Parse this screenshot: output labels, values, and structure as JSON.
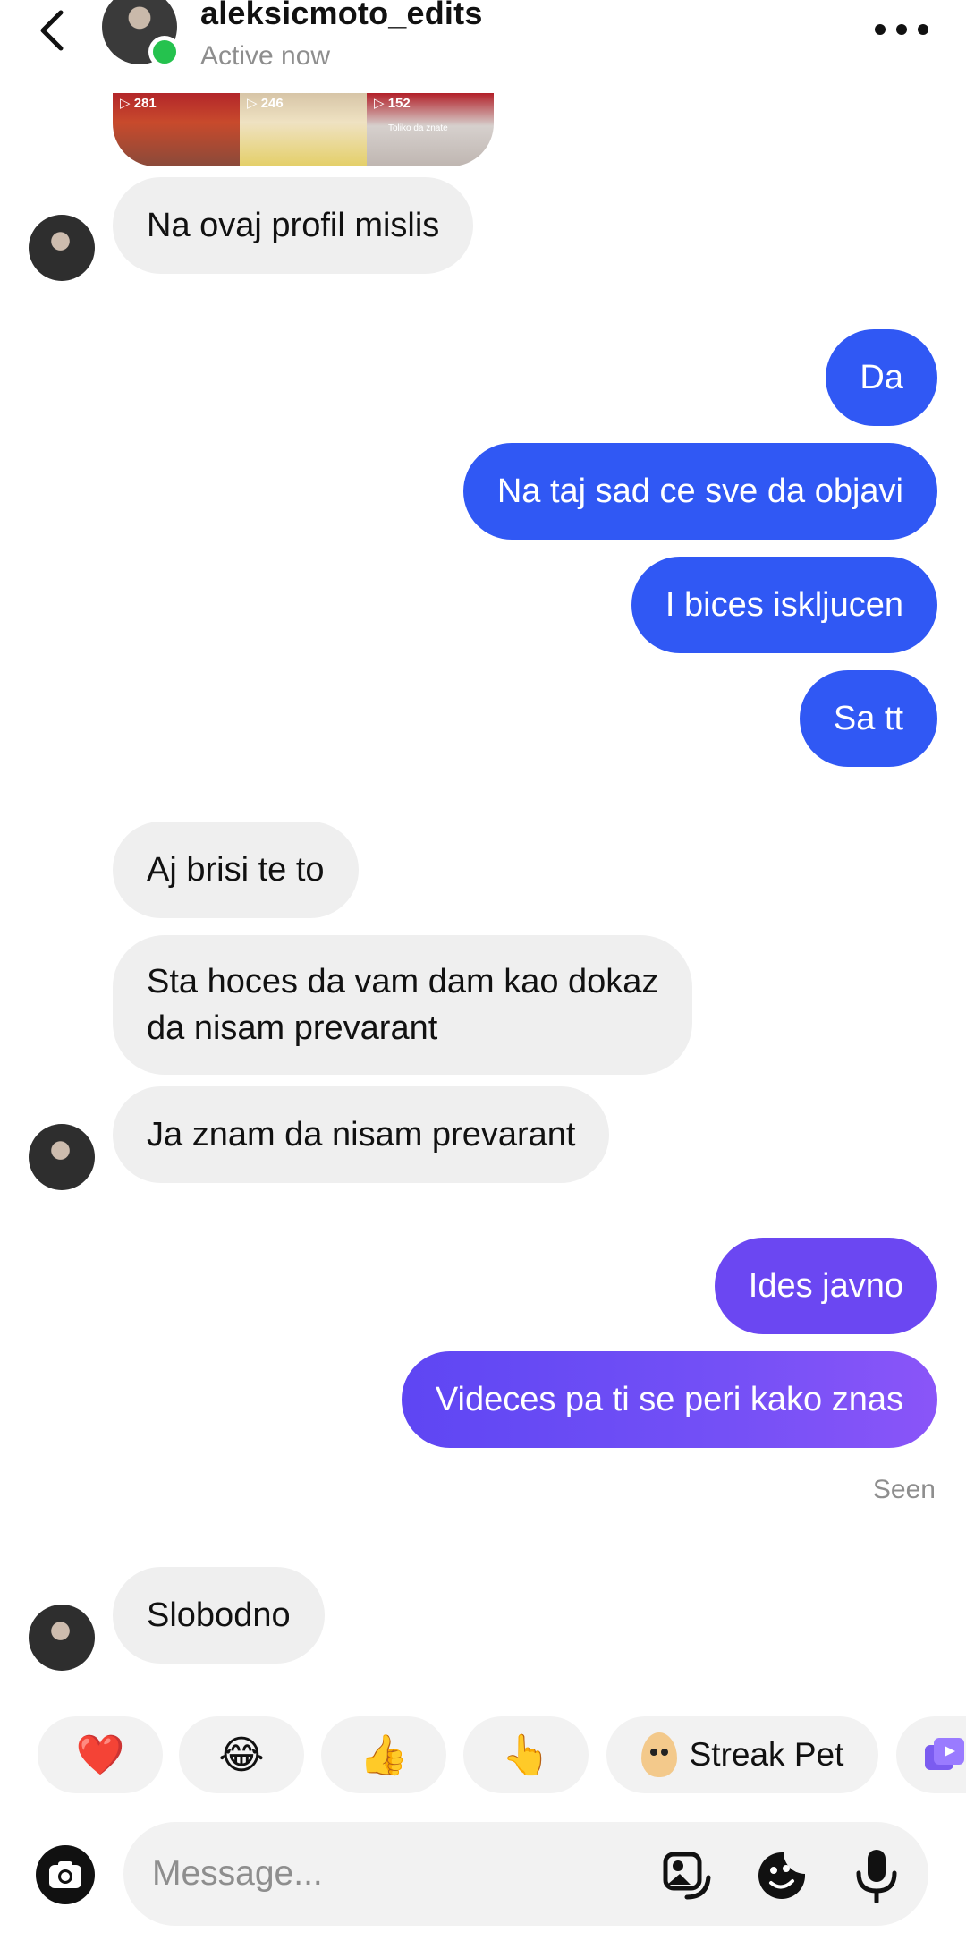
{
  "header": {
    "username": "aleksicmoto_edits",
    "status": "Active now",
    "back_icon": "chevron-left-icon",
    "more_icon": "more-horizontal-icon"
  },
  "shared_post": {
    "counts": [
      "281",
      "246",
      "152"
    ],
    "caption": "Toliko da znate"
  },
  "messages": {
    "m1": "Na ovaj profil mislis",
    "m2": "Da",
    "m3": "Na taj  sad ce sve da objavi",
    "m4": "I bices iskljucen",
    "m5": "Sa tt",
    "m6": "Aj brisi te to",
    "m7a": "Sta hoces da vam dam kao dokaz",
    "m7b": "da nisam prevarant",
    "m8": "Ja znam da nisam prevarant",
    "m9": "Ides javno",
    "m10": "Videces pa ti se peri kako znas",
    "seen": "Seen",
    "m11": "Slobodno"
  },
  "quick_reactions": {
    "r1": "❤️",
    "r2": "😂",
    "r3": "👍",
    "r4": "👆",
    "streak_label": "Streak Pet"
  },
  "composer": {
    "placeholder": "Message...",
    "icons": [
      "camera-icon",
      "sticker-photo-icon",
      "sticker-icon",
      "microphone-icon"
    ]
  },
  "colors": {
    "sent_blue": "#3058f4",
    "sent_violet": "#6b47f2",
    "received_bg": "#efefef",
    "online": "#25c24e"
  }
}
